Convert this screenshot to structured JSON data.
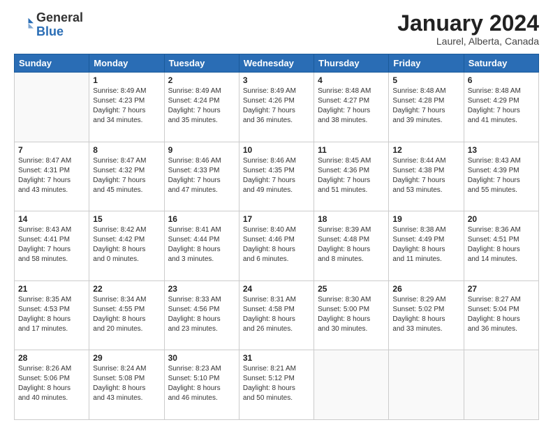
{
  "header": {
    "logo_general": "General",
    "logo_blue": "Blue",
    "month_title": "January 2024",
    "location": "Laurel, Alberta, Canada"
  },
  "weekdays": [
    "Sunday",
    "Monday",
    "Tuesday",
    "Wednesday",
    "Thursday",
    "Friday",
    "Saturday"
  ],
  "weeks": [
    [
      {
        "day": "",
        "info": ""
      },
      {
        "day": "1",
        "info": "Sunrise: 8:49 AM\nSunset: 4:23 PM\nDaylight: 7 hours\nand 34 minutes."
      },
      {
        "day": "2",
        "info": "Sunrise: 8:49 AM\nSunset: 4:24 PM\nDaylight: 7 hours\nand 35 minutes."
      },
      {
        "day": "3",
        "info": "Sunrise: 8:49 AM\nSunset: 4:26 PM\nDaylight: 7 hours\nand 36 minutes."
      },
      {
        "day": "4",
        "info": "Sunrise: 8:48 AM\nSunset: 4:27 PM\nDaylight: 7 hours\nand 38 minutes."
      },
      {
        "day": "5",
        "info": "Sunrise: 8:48 AM\nSunset: 4:28 PM\nDaylight: 7 hours\nand 39 minutes."
      },
      {
        "day": "6",
        "info": "Sunrise: 8:48 AM\nSunset: 4:29 PM\nDaylight: 7 hours\nand 41 minutes."
      }
    ],
    [
      {
        "day": "7",
        "info": "Sunrise: 8:47 AM\nSunset: 4:31 PM\nDaylight: 7 hours\nand 43 minutes."
      },
      {
        "day": "8",
        "info": "Sunrise: 8:47 AM\nSunset: 4:32 PM\nDaylight: 7 hours\nand 45 minutes."
      },
      {
        "day": "9",
        "info": "Sunrise: 8:46 AM\nSunset: 4:33 PM\nDaylight: 7 hours\nand 47 minutes."
      },
      {
        "day": "10",
        "info": "Sunrise: 8:46 AM\nSunset: 4:35 PM\nDaylight: 7 hours\nand 49 minutes."
      },
      {
        "day": "11",
        "info": "Sunrise: 8:45 AM\nSunset: 4:36 PM\nDaylight: 7 hours\nand 51 minutes."
      },
      {
        "day": "12",
        "info": "Sunrise: 8:44 AM\nSunset: 4:38 PM\nDaylight: 7 hours\nand 53 minutes."
      },
      {
        "day": "13",
        "info": "Sunrise: 8:43 AM\nSunset: 4:39 PM\nDaylight: 7 hours\nand 55 minutes."
      }
    ],
    [
      {
        "day": "14",
        "info": "Sunrise: 8:43 AM\nSunset: 4:41 PM\nDaylight: 7 hours\nand 58 minutes."
      },
      {
        "day": "15",
        "info": "Sunrise: 8:42 AM\nSunset: 4:42 PM\nDaylight: 8 hours\nand 0 minutes."
      },
      {
        "day": "16",
        "info": "Sunrise: 8:41 AM\nSunset: 4:44 PM\nDaylight: 8 hours\nand 3 minutes."
      },
      {
        "day": "17",
        "info": "Sunrise: 8:40 AM\nSunset: 4:46 PM\nDaylight: 8 hours\nand 6 minutes."
      },
      {
        "day": "18",
        "info": "Sunrise: 8:39 AM\nSunset: 4:48 PM\nDaylight: 8 hours\nand 8 minutes."
      },
      {
        "day": "19",
        "info": "Sunrise: 8:38 AM\nSunset: 4:49 PM\nDaylight: 8 hours\nand 11 minutes."
      },
      {
        "day": "20",
        "info": "Sunrise: 8:36 AM\nSunset: 4:51 PM\nDaylight: 8 hours\nand 14 minutes."
      }
    ],
    [
      {
        "day": "21",
        "info": "Sunrise: 8:35 AM\nSunset: 4:53 PM\nDaylight: 8 hours\nand 17 minutes."
      },
      {
        "day": "22",
        "info": "Sunrise: 8:34 AM\nSunset: 4:55 PM\nDaylight: 8 hours\nand 20 minutes."
      },
      {
        "day": "23",
        "info": "Sunrise: 8:33 AM\nSunset: 4:56 PM\nDaylight: 8 hours\nand 23 minutes."
      },
      {
        "day": "24",
        "info": "Sunrise: 8:31 AM\nSunset: 4:58 PM\nDaylight: 8 hours\nand 26 minutes."
      },
      {
        "day": "25",
        "info": "Sunrise: 8:30 AM\nSunset: 5:00 PM\nDaylight: 8 hours\nand 30 minutes."
      },
      {
        "day": "26",
        "info": "Sunrise: 8:29 AM\nSunset: 5:02 PM\nDaylight: 8 hours\nand 33 minutes."
      },
      {
        "day": "27",
        "info": "Sunrise: 8:27 AM\nSunset: 5:04 PM\nDaylight: 8 hours\nand 36 minutes."
      }
    ],
    [
      {
        "day": "28",
        "info": "Sunrise: 8:26 AM\nSunset: 5:06 PM\nDaylight: 8 hours\nand 40 minutes."
      },
      {
        "day": "29",
        "info": "Sunrise: 8:24 AM\nSunset: 5:08 PM\nDaylight: 8 hours\nand 43 minutes."
      },
      {
        "day": "30",
        "info": "Sunrise: 8:23 AM\nSunset: 5:10 PM\nDaylight: 8 hours\nand 46 minutes."
      },
      {
        "day": "31",
        "info": "Sunrise: 8:21 AM\nSunset: 5:12 PM\nDaylight: 8 hours\nand 50 minutes."
      },
      {
        "day": "",
        "info": ""
      },
      {
        "day": "",
        "info": ""
      },
      {
        "day": "",
        "info": ""
      }
    ]
  ]
}
